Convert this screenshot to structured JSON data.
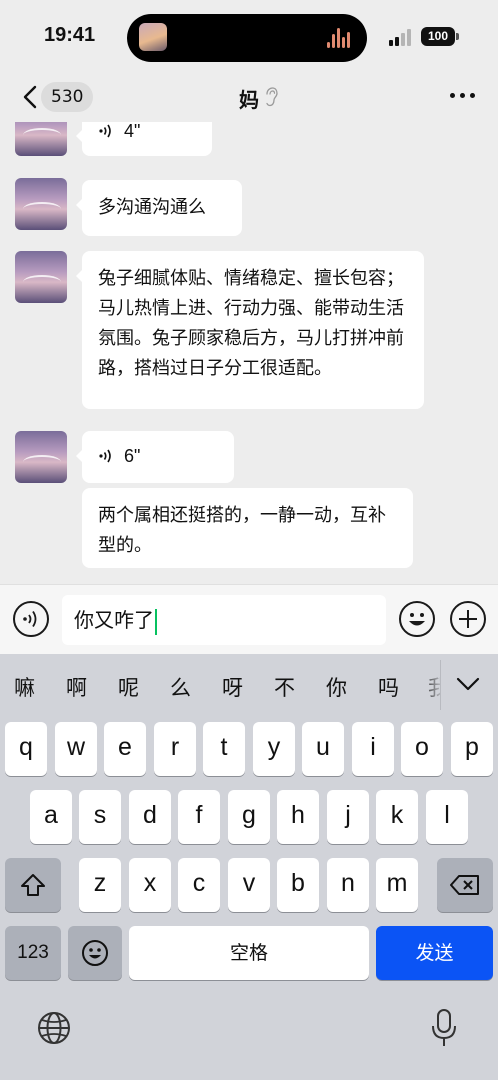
{
  "status_bar": {
    "time": "19:41",
    "battery": "100"
  },
  "nav": {
    "back_count": "530",
    "title": "妈"
  },
  "messages": [
    {
      "type": "voice",
      "duration": "4\""
    },
    {
      "type": "text",
      "text": "多沟通沟通么"
    },
    {
      "type": "text",
      "text": "兔子细腻体贴、情绪稳定、擅长包容；马儿热情上进、行动力强、能带动生活氛围。兔子顾家稳后方，马儿打拼冲前路，搭档过日子分工很适配。"
    },
    {
      "type": "voice",
      "duration": "6\""
    },
    {
      "type": "text",
      "text": "两个属相还挺搭的，一静一动，互补型的。"
    }
  ],
  "input": {
    "value": "你又咋了"
  },
  "keyboard": {
    "candidates": [
      "嘛",
      "啊",
      "呢",
      "么",
      "呀",
      "不",
      "你",
      "吗",
      "我"
    ],
    "row1": [
      "q",
      "w",
      "e",
      "r",
      "t",
      "y",
      "u",
      "i",
      "o",
      "p"
    ],
    "row2": [
      "a",
      "s",
      "d",
      "f",
      "g",
      "h",
      "j",
      "k",
      "l"
    ],
    "row3": [
      "z",
      "x",
      "c",
      "v",
      "b",
      "n",
      "m"
    ],
    "numbers_label": "123",
    "space_label": "空格",
    "send_label": "发送"
  },
  "icons": {
    "back": "chevron-left-icon",
    "ear": "ear-icon",
    "more": "more-dots-icon",
    "voice_toggle": "voice-icon",
    "emoji": "emoji-icon",
    "plus": "plus-icon",
    "shift": "shift-icon",
    "delete": "backspace-icon",
    "globe": "globe-icon",
    "mic": "microphone-icon"
  },
  "colors": {
    "send": "#0b54f5",
    "caret": "#07c160",
    "chat_bg": "#ededed"
  }
}
